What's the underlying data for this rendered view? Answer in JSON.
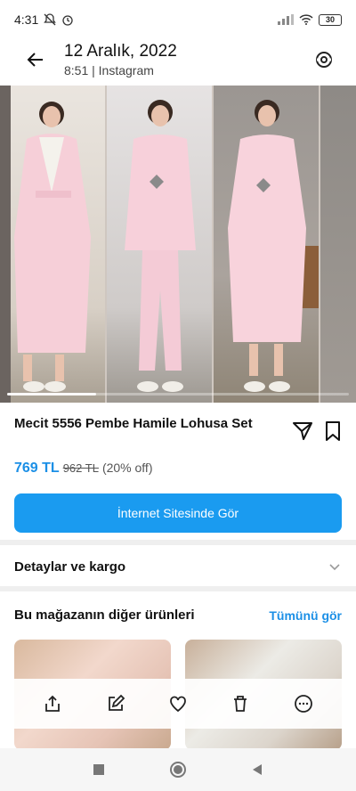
{
  "status": {
    "time": "4:31",
    "battery": "30"
  },
  "header": {
    "date": "12 Aralık, 2022",
    "subtitle": "8:51 | Instagram"
  },
  "product": {
    "title": "Mecit 5556 Pembe Hamile Lohusa Set",
    "price": "769 TL",
    "old_price": "962 TL",
    "discount": "(20% off)"
  },
  "cta_label": "İnternet Sitesinde Gör",
  "details_label": "Detaylar ve kargo",
  "more_section": {
    "title": "Bu mağazanın diğer ürünleri",
    "see_all": "Tümünü gör"
  },
  "carousel": {
    "current": 1,
    "total": 4
  },
  "colors": {
    "accent": "#1a9bf0",
    "link": "#1b8fe6"
  }
}
